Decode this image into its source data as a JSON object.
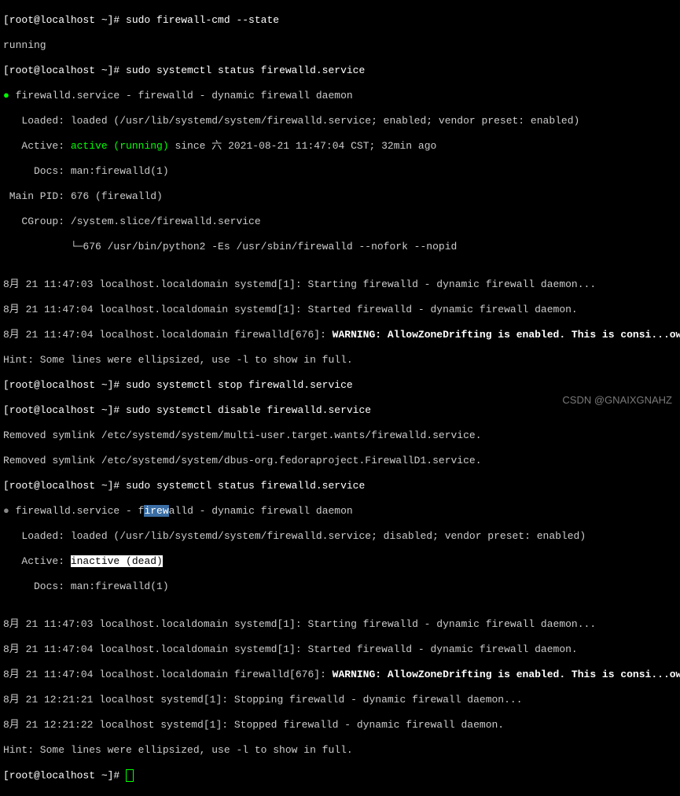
{
  "prompt": "[root@localhost ~]# ",
  "cmd": {
    "state": "sudo firewall-cmd --state",
    "status1": "sudo systemctl status firewalld.service",
    "stop": "sudo systemctl stop firewalld.service",
    "disable": "sudo systemctl disable firewalld.service",
    "status2": "sudo systemctl status firewalld.service"
  },
  "out": {
    "running": "running",
    "bullet": "●",
    "svc_line1": " firewalld.service - firewalld - dynamic firewall daemon",
    "loaded_enabled": "   Loaded: loaded (/usr/lib/systemd/system/firewalld.service; enabled; vendor preset: enabled)",
    "active_lbl": "   Active: ",
    "active_running": "active (running)",
    "active_since": " since 六 2021-08-21 11:47:04 CST; 32min ago",
    "docs": "     Docs: man:firewalld(1)",
    "mainpid": " Main PID: 676 (firewalld)",
    "cgroup": "   CGroup: /system.slice/firewalld.service",
    "cgroup_child": "           └─676 /usr/bin/python2 -Es /usr/sbin/firewalld --nofork --nopid",
    "blank": "",
    "log1": "8月 21 11:47:03 localhost.localdomain systemd[1]: Starting firewalld - dynamic firewall daemon...",
    "log2": "8月 21 11:47:04 localhost.localdomain systemd[1]: Started firewalld - dynamic firewall daemon.",
    "log3_pre": "8月 21 11:47:04 localhost.localdomain firewalld[676]: ",
    "log3_warn": "WARNING: AllowZoneDrifting is enabled. This is consi...ow.",
    "hint": "Hint: Some lines were ellipsized, use -l to show in full.",
    "rm1": "Removed symlink /etc/systemd/system/multi-user.target.wants/firewalld.service.",
    "rm2": "Removed symlink /etc/systemd/system/dbus-org.fedoraproject.FirewallD1.service.",
    "svc2_pre": " firewalld.service - f",
    "svc2_hl": "irew",
    "svc2_post": "alld - dynamic firewall daemon",
    "loaded_disabled": "   Loaded: loaded (/usr/lib/systemd/system/firewalld.service; disabled; vendor preset: enabled)",
    "inactive": "inactive (dead)",
    "log_stop": "8月 21 12:21:21 localhost systemd[1]: Stopping firewalld - dynamic firewall daemon...",
    "log_stopped": "8月 21 12:21:22 localhost systemd[1]: Stopped firewalld - dynamic firewall daemon."
  },
  "watermark": "CSDN @GNAIXGNAHZ"
}
